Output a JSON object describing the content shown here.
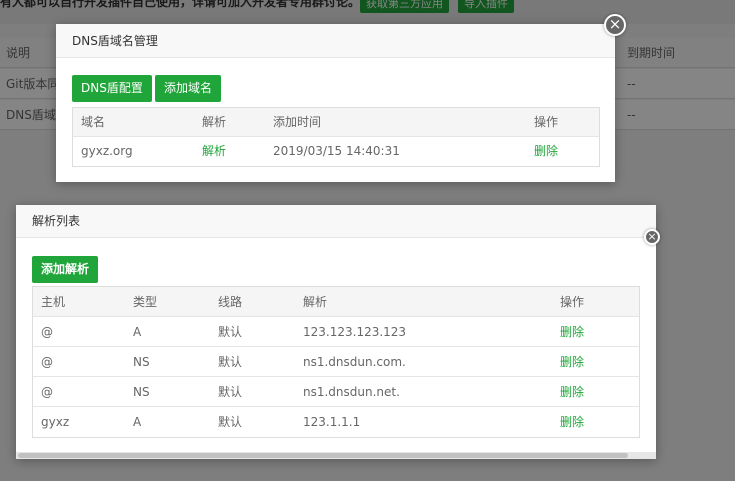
{
  "background": {
    "notice_text": "有人都可以自行开发插件自己使用，详请可加入开发者专用群讨论。",
    "buttons": [
      "获取第三方应用",
      "导入插件"
    ],
    "table": {
      "headers": {
        "desc": "说明",
        "expiry": "到期时间"
      },
      "rows": [
        {
          "desc": "Git版本同",
          "expiry": "--"
        },
        {
          "desc": "DNS盾域",
          "expiry": "--"
        }
      ]
    }
  },
  "dialog_domains": {
    "title": "DNS盾域名管理",
    "close_symbol": "×",
    "config_button": "DNS盾配置",
    "add_domain_button": "添加域名",
    "headers": {
      "domain": "域名",
      "resolve": "解析",
      "added": "添加时间",
      "action": "操作"
    },
    "rows": [
      {
        "domain": "gyxz.org",
        "resolve": "解析",
        "added": "2019/03/15 14:40:31",
        "action": "删除"
      }
    ]
  },
  "dialog_records": {
    "title": "解析列表",
    "add_button": "添加解析",
    "headers": {
      "host": "主机",
      "type": "类型",
      "line": "线路",
      "value": "解析",
      "action": "操作"
    },
    "rows": [
      {
        "host": "@",
        "type": "A",
        "line": "默认",
        "value": "123.123.123.123",
        "action": "删除"
      },
      {
        "host": "@",
        "type": "NS",
        "line": "默认",
        "value": "ns1.dnsdun.com.",
        "action": "删除"
      },
      {
        "host": "@",
        "type": "NS",
        "line": "默认",
        "value": "ns1.dnsdun.net.",
        "action": "删除"
      },
      {
        "host": "gyxz",
        "type": "A",
        "line": "默认",
        "value": "123.1.1.1",
        "action": "删除"
      }
    ]
  },
  "colors": {
    "accent": "#20a53a",
    "overlay": "rgba(0,0,0,0.48)"
  }
}
